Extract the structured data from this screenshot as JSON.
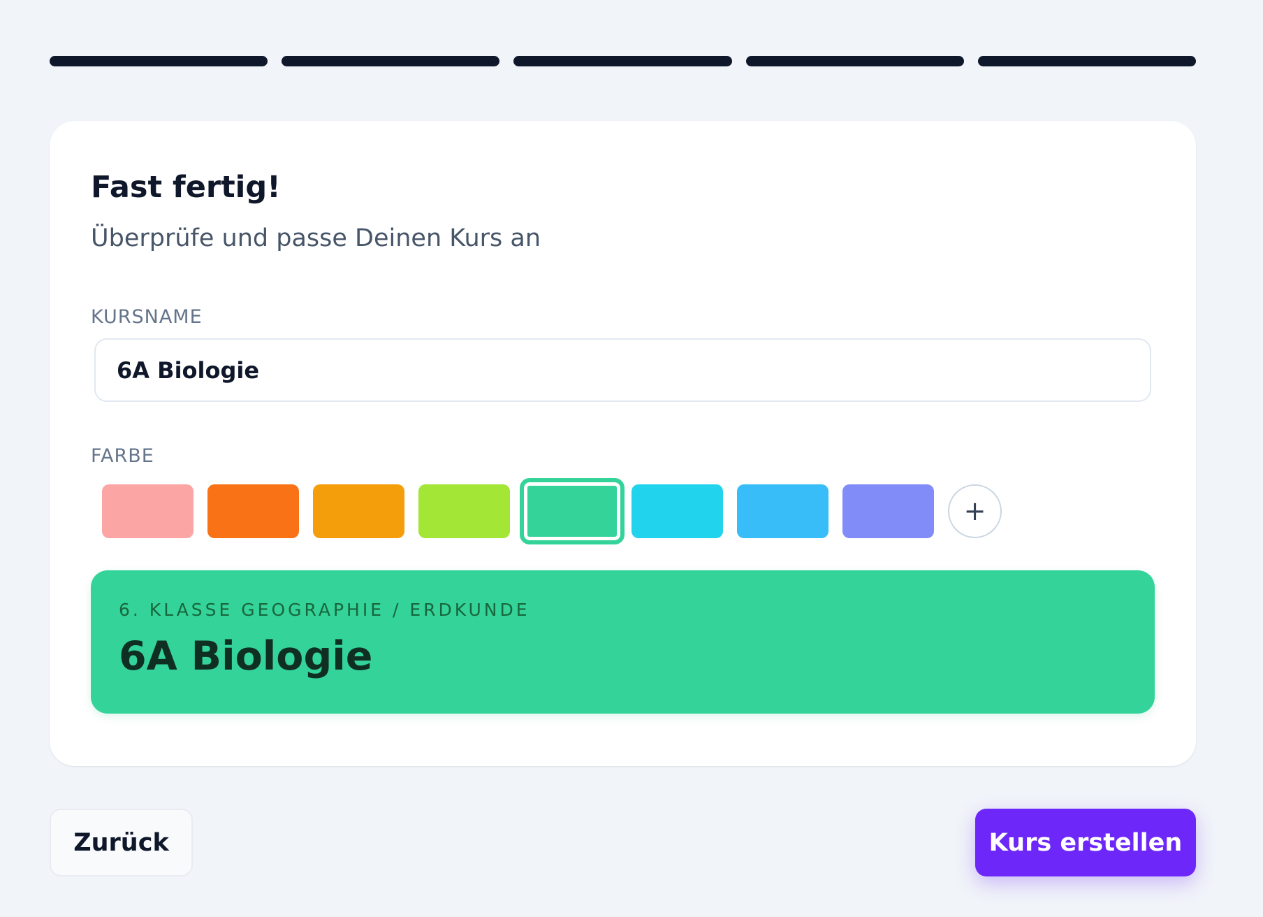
{
  "progress": {
    "steps_total": 5,
    "steps_completed": 5,
    "color": "#0f172a"
  },
  "card": {
    "title": "Fast fertig!",
    "subtitle": "Überprüfe und passe Deinen Kurs an"
  },
  "course_name": {
    "label": "KURSNAME",
    "value": "6A Biologie"
  },
  "color_picker": {
    "label": "FARBE",
    "swatches": [
      {
        "color": "#fca5a5",
        "selected": false
      },
      {
        "color": "#f97316",
        "selected": false
      },
      {
        "color": "#f59e0b",
        "selected": false
      },
      {
        "color": "#a3e635",
        "selected": false
      },
      {
        "color": "#34d399",
        "selected": true
      },
      {
        "color": "#22d3ee",
        "selected": false
      },
      {
        "color": "#38bdf8",
        "selected": false
      },
      {
        "color": "#818cf8",
        "selected": false
      }
    ],
    "add_label": "+",
    "add_icon": "plus-icon"
  },
  "preview": {
    "kicker": "6. KLASSE GEOGRAPHIE / ERDKUNDE",
    "title": "6A Biologie",
    "background": "#34d399"
  },
  "actions": {
    "back_label": "Zurück",
    "create_label": "Kurs erstellen",
    "accent_color": "#6d28f9"
  }
}
